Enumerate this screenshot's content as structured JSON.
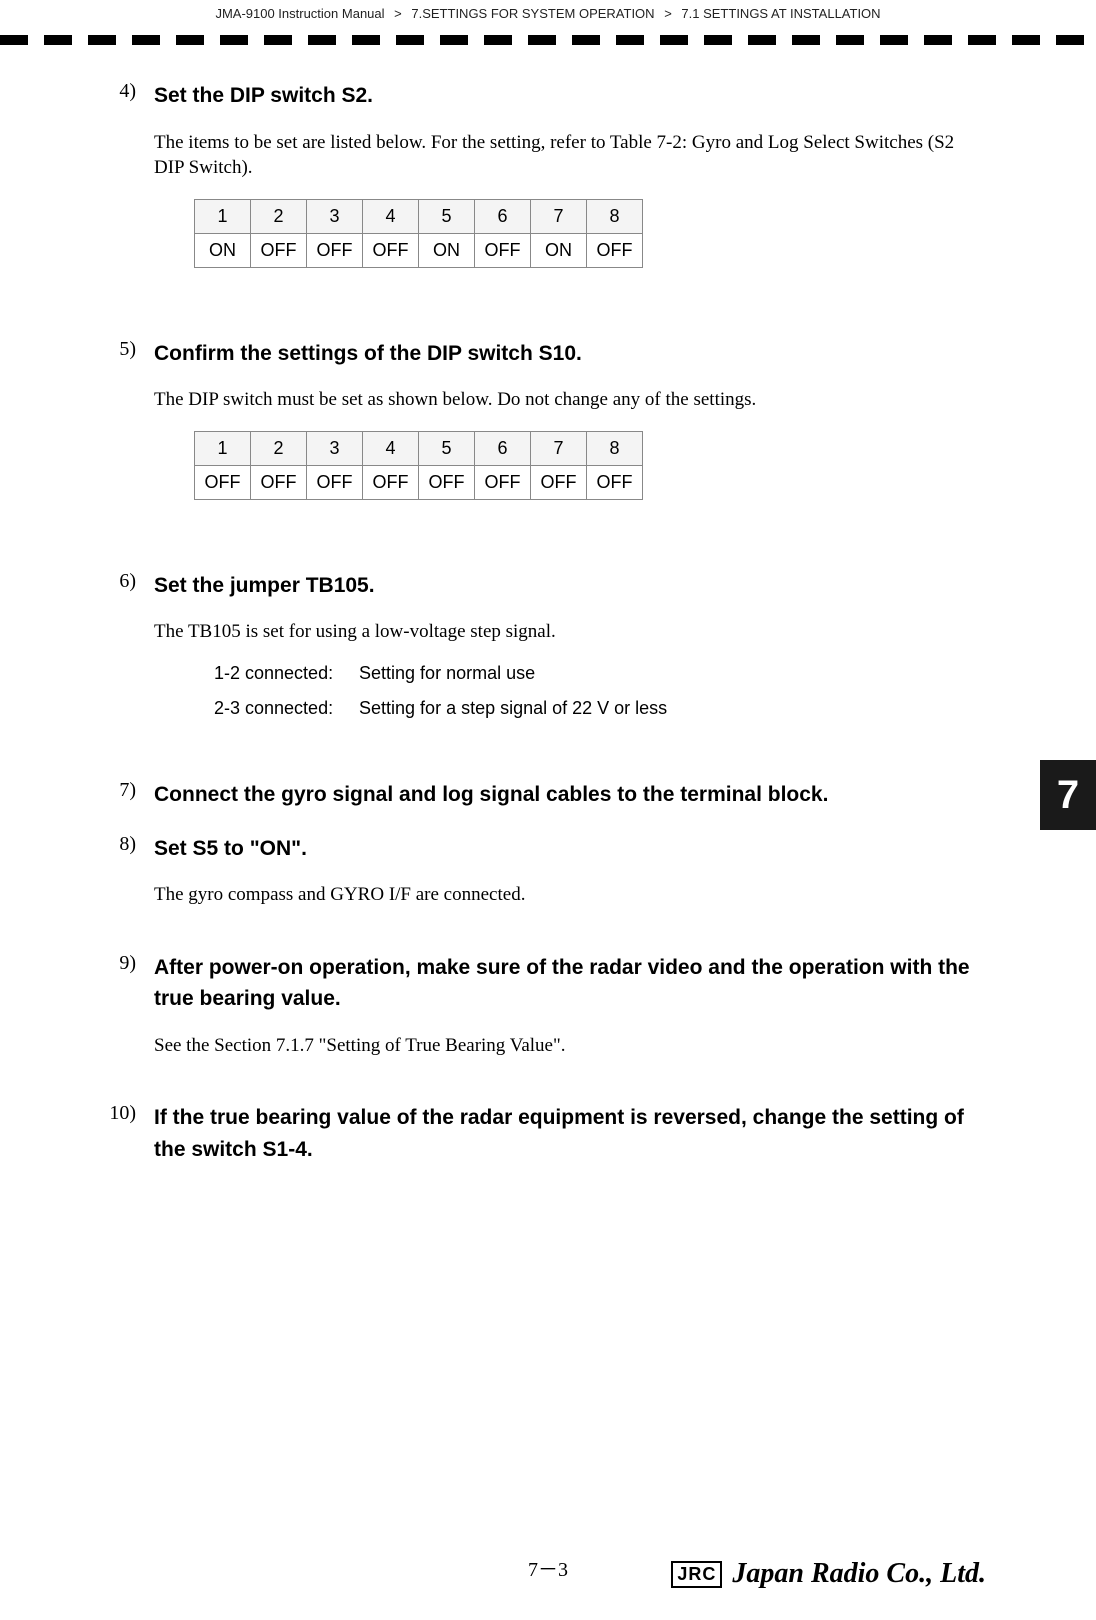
{
  "breadcrumb": {
    "a": "JMA-9100 Instruction Manual",
    "b": "7.SETTINGS FOR SYSTEM OPERATION",
    "c": "7.1  SETTINGS AT INSTALLATION",
    "sep": ">"
  },
  "side_tab": "7",
  "page_number": "7－3",
  "logo": {
    "box": "JRC",
    "script": "Japan Radio Co., Ltd."
  },
  "steps": {
    "s4": {
      "num": "4)",
      "title": "Set the DIP switch S2.",
      "para": "The items to be set are listed below. For the setting, refer to Table 7-2: Gyro and Log Select Switches (S2 DIP Switch).",
      "headers": [
        "1",
        "2",
        "3",
        "4",
        "5",
        "6",
        "7",
        "8"
      ],
      "values": [
        "ON",
        "OFF",
        "OFF",
        "OFF",
        "ON",
        "OFF",
        "ON",
        "OFF"
      ]
    },
    "s5": {
      "num": "5)",
      "title": "Confirm the settings of the DIP switch S10.",
      "para": "The DIP switch must be set as shown below. Do not change any of the settings.",
      "headers": [
        "1",
        "2",
        "3",
        "4",
        "5",
        "6",
        "7",
        "8"
      ],
      "values": [
        "OFF",
        "OFF",
        "OFF",
        "OFF",
        "OFF",
        "OFF",
        "OFF",
        "OFF"
      ]
    },
    "s6": {
      "num": "6)",
      "title": "Set the jumper TB105.",
      "para": "The TB105 is set for using a low-voltage step signal.",
      "j1_label": "1-2 connected:",
      "j1_desc": "Setting for normal use",
      "j2_label": "2-3 connected:",
      "j2_desc": "Setting for a step signal of 22 V or less"
    },
    "s7": {
      "num": "7)",
      "title": "Connect the gyro signal and log signal cables to the terminal block."
    },
    "s8": {
      "num": "8)",
      "title": "Set S5 to \"ON\".",
      "para": "The gyro compass and GYRO I/F are connected."
    },
    "s9": {
      "num": "9)",
      "title": "After power-on operation, make sure of the radar video and the operation with the true bearing value.",
      "para": "See the Section 7.1.7 \"Setting of True Bearing Value\"."
    },
    "s10": {
      "num": "10)",
      "title": "If the true bearing value of the radar equipment is reversed, change the setting of the switch S1-4."
    }
  }
}
